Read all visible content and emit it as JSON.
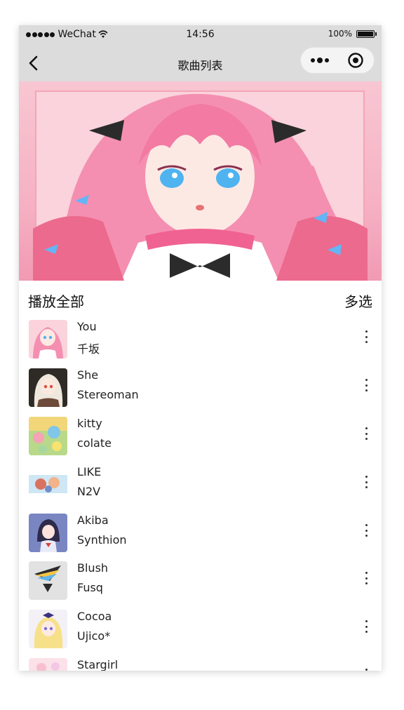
{
  "status_bar": {
    "carrier": "WeChat",
    "time": "14:56",
    "battery": "100%"
  },
  "nav": {
    "title": "歌曲列表"
  },
  "controls": {
    "play_all": "播放全部",
    "multi_select": "多选"
  },
  "songs": [
    {
      "title": "You",
      "artist": "千坂"
    },
    {
      "title": "She",
      "artist": "Stereoman"
    },
    {
      "title": "kitty",
      "artist": "colate"
    },
    {
      "title": "LIKE",
      "artist": "N2V"
    },
    {
      "title": "Akiba",
      "artist": "Synthion"
    },
    {
      "title": "Blush",
      "artist": "Fusq"
    },
    {
      "title": "Cocoa",
      "artist": "Ujico*"
    },
    {
      "title": "Stargirl",
      "artist": ""
    }
  ],
  "colors": {
    "bar_background": "#dcdcdc",
    "cover_pink": "#f6b2c4",
    "text": "#222222"
  },
  "icons": {
    "back": "chevron-left-icon",
    "more": "more-dots-icon",
    "close": "target-circle-icon",
    "song_menu": "vertical-dots-icon"
  }
}
